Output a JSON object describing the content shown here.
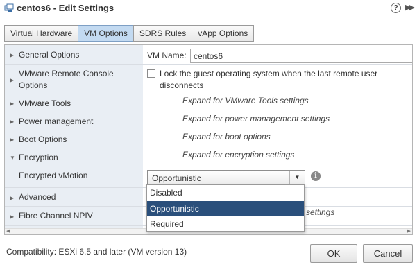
{
  "window": {
    "title": "centos6 - Edit Settings",
    "help_label": "?",
    "expand_label": "▶▶"
  },
  "tabs": [
    {
      "label": "Virtual Hardware",
      "active": false
    },
    {
      "label": "VM Options",
      "active": true
    },
    {
      "label": "SDRS Rules",
      "active": false
    },
    {
      "label": "vApp Options",
      "active": false
    }
  ],
  "settings": {
    "general_options": {
      "label": "General Options",
      "vm_name_label": "VM Name:",
      "vm_name_value": "centos6"
    },
    "remote_console": {
      "label": "VMware Remote Console Options",
      "lock_text": "Lock the guest operating system when the last remote user disconnects",
      "lock_checked": false
    },
    "vmware_tools": {
      "label": "VMware Tools",
      "hint": "Expand for VMware Tools settings"
    },
    "power_management": {
      "label": "Power management",
      "hint": "Expand for power management settings"
    },
    "boot_options": {
      "label": "Boot Options",
      "hint": "Expand for boot options"
    },
    "encryption": {
      "label": "Encryption",
      "hint": "Expand for encryption settings",
      "expanded": true
    },
    "encrypted_vmotion": {
      "label": "Encrypted vMotion",
      "value": "Opportunistic"
    },
    "advanced": {
      "label": "Advanced"
    },
    "fibre_channel": {
      "label": "Fibre Channel NPIV",
      "hint_partial": "settings"
    }
  },
  "dropdown": {
    "options": [
      "Disabled",
      "Opportunistic",
      "Required"
    ],
    "selected": "Opportunistic"
  },
  "footer": {
    "compatibility": "Compatibility: ESXi 6.5 and later (VM version 13)",
    "ok_label": "OK",
    "cancel_label": "Cancel"
  },
  "colors": {
    "tab_active": "#c3daf1",
    "left_column": "#e9eef4",
    "dropdown_selected": "#2a4f7b"
  }
}
